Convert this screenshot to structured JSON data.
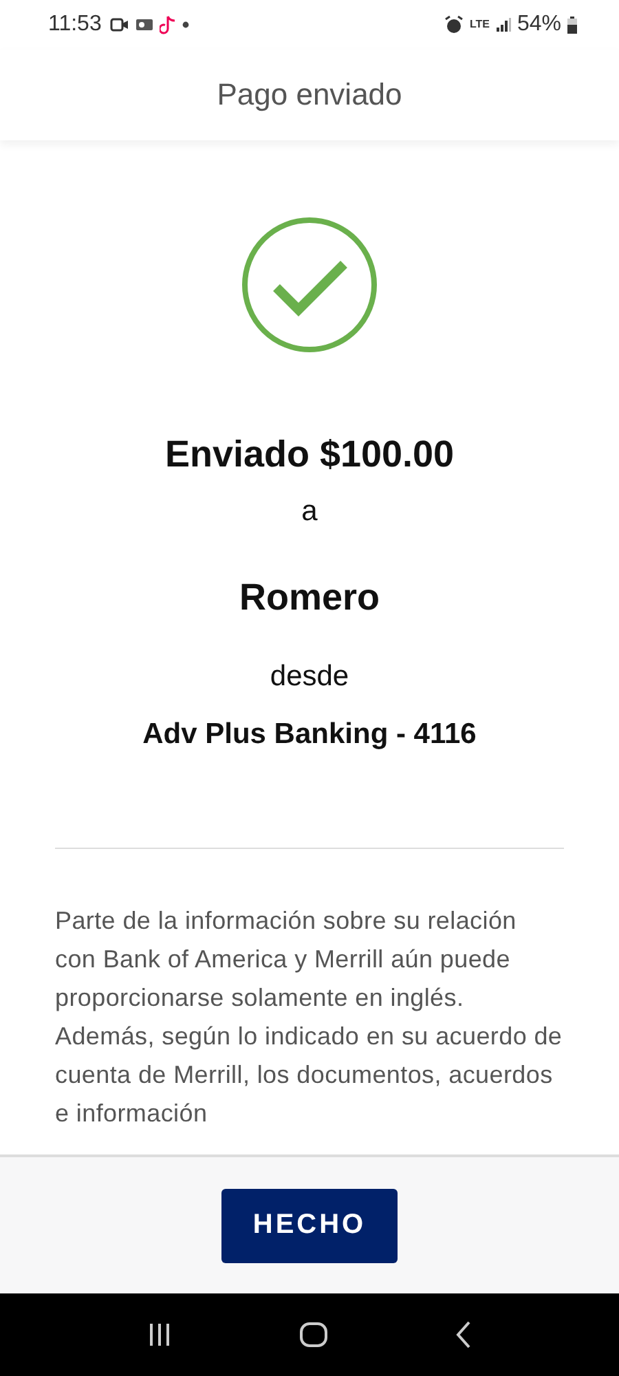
{
  "status_bar": {
    "time": "11:53",
    "network": "LTE",
    "battery": "54%"
  },
  "header": {
    "title": "Pago enviado"
  },
  "confirmation": {
    "amount": "Enviado $100.00",
    "to_word": "a",
    "recipient": "Romero",
    "from_word": "desde",
    "account": "Adv Plus Banking - 4116"
  },
  "disclaimer": "Parte de la información sobre su relación con Bank of America y Merrill aún puede proporcionarse solamente en inglés. Además, según lo indicado en su acuerdo de cuenta de Merrill, los documentos, acuerdos e información",
  "footer": {
    "button": "HECHO"
  }
}
